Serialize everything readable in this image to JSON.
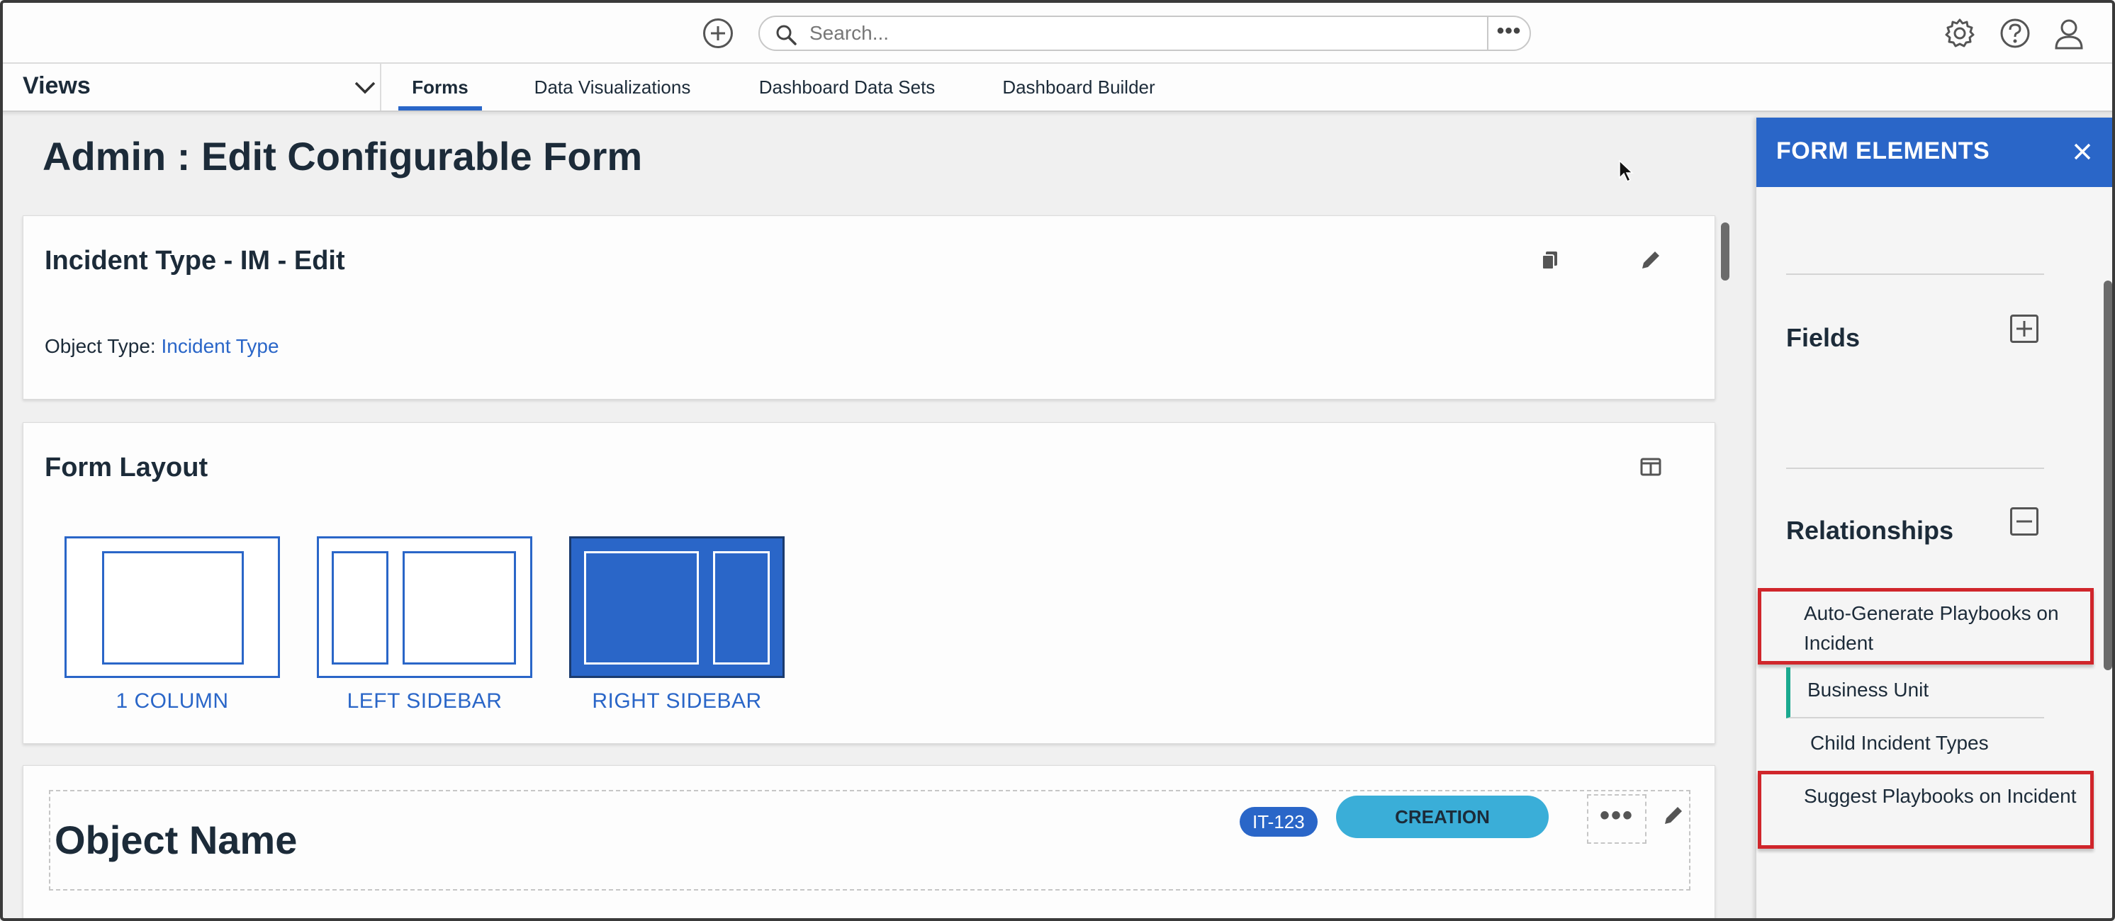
{
  "topbar": {
    "search_placeholder": "Search...",
    "icons": [
      "add-icon",
      "search-icon",
      "more-icon",
      "gear-icon",
      "help-icon",
      "user-icon"
    ]
  },
  "navbar": {
    "views_label": "Views",
    "tabs": [
      {
        "label": "Forms",
        "active": true
      },
      {
        "label": "Data Visualizations",
        "active": false
      },
      {
        "label": "Dashboard Data Sets",
        "active": false
      },
      {
        "label": "Dashboard Builder",
        "active": false
      }
    ]
  },
  "page": {
    "title": "Admin : Edit Configurable Form"
  },
  "form_card": {
    "title": "Incident Type - IM - Edit",
    "object_type_label": "Object Type:",
    "object_type_value": "Incident Type"
  },
  "layout_card": {
    "title": "Form Layout",
    "options": [
      {
        "label": "1 COLUMN",
        "selected": false
      },
      {
        "label": "LEFT SIDEBAR",
        "selected": false
      },
      {
        "label": "RIGHT SIDEBAR",
        "selected": true
      }
    ]
  },
  "object_card": {
    "name": "Object Name",
    "id_badge": "IT-123",
    "status": "CREATION"
  },
  "panel": {
    "title": "FORM ELEMENTS",
    "fields_title": "Fields",
    "relationships_title": "Relationships",
    "relationships": [
      {
        "label": "Auto-Generate Playbooks on Incident",
        "highlighted": true
      },
      {
        "label": "Business Unit",
        "active": true
      },
      {
        "label": "Child Incident Types"
      },
      {
        "label": "Suggest Playbooks on Incident",
        "highlighted": true
      }
    ]
  },
  "colors": {
    "accent": "#2a66c8",
    "status_badge": "#3aaed8",
    "highlight_border": "#d0262b",
    "active_marker": "#1aa98f"
  }
}
